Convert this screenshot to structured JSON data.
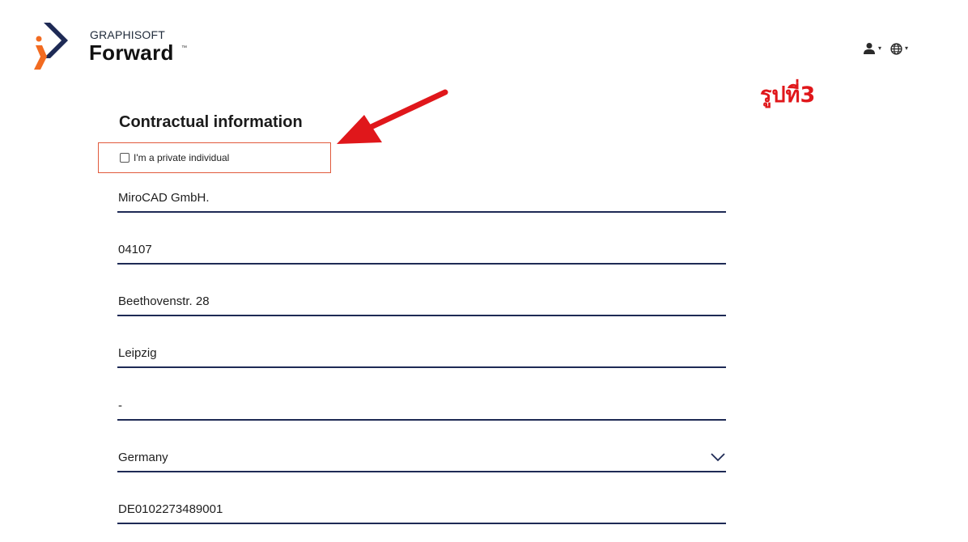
{
  "header": {
    "brand_top": "GRAPHISOFT",
    "brand_main": "Forward",
    "brand_tm": "™",
    "user_icon": "user-icon",
    "globe_icon": "globe-icon",
    "caret": "▾"
  },
  "annotation": {
    "label": "รูปที่3",
    "color": "#e0171b"
  },
  "form": {
    "title": "Contractual information",
    "private_individual": {
      "label": "I'm a private individual",
      "checked": false
    },
    "fields": [
      {
        "value": "MiroCAD GmbH."
      },
      {
        "value": "04107"
      },
      {
        "value": "Beethovenstr. 28"
      },
      {
        "value": "Leipzig"
      },
      {
        "value": "-"
      },
      {
        "value": "Germany",
        "type": "select"
      },
      {
        "value": "DE0102273489001"
      }
    ],
    "underline_color": "#1e2a55"
  }
}
